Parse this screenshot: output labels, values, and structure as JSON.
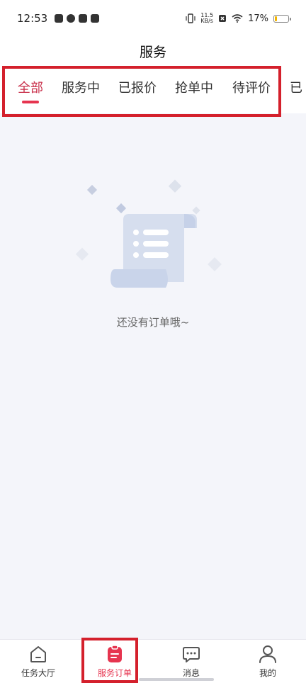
{
  "status_bar": {
    "time": "12:53",
    "net_speed_value": "11.5",
    "net_speed_unit": "KB/s",
    "battery_percent": "17%",
    "battery_level": 0.17
  },
  "header": {
    "title": "服务"
  },
  "tabs": [
    {
      "label": "全部",
      "active": true
    },
    {
      "label": "服务中",
      "active": false
    },
    {
      "label": "已报价",
      "active": false
    },
    {
      "label": "抢单中",
      "active": false
    },
    {
      "label": "待评价",
      "active": false
    },
    {
      "label": "已",
      "active": false
    }
  ],
  "empty_state": {
    "message": "还没有订单哦~"
  },
  "bottom_nav": [
    {
      "label": "任务大厅",
      "icon": "home-icon",
      "active": false
    },
    {
      "label": "服务订单",
      "icon": "clipboard-icon",
      "active": true
    },
    {
      "label": "消息",
      "icon": "chat-icon",
      "active": false
    },
    {
      "label": "我的",
      "icon": "person-icon",
      "active": false
    }
  ],
  "colors": {
    "accent": "#e6344f",
    "active_tab_text": "#c9304b",
    "highlight_box": "#d4202c",
    "background": "#f4f5fa"
  }
}
